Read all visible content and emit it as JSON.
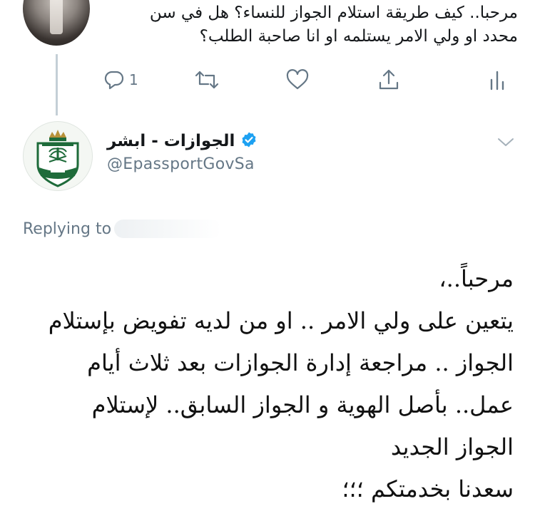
{
  "tweet": {
    "text_lines": [
      "مرحبا.. كيف طريقة استلام الجواز للنساء؟ هل في سن",
      "محدد او ولي الامر يستلمه او انا صاحبة الطلب؟"
    ],
    "reply_count": "1"
  },
  "reply": {
    "author_name": "الجوازات - ابشر",
    "handle": "@EpassportGovSa",
    "verified": true,
    "replying_to_label": "Replying to",
    "body_lines": [
      "مرحباً..،",
      "يتعين على ولي الامر .. او من لديه تفويض بإستلام",
      "الجواز .. مراجعة إدارة الجوازات بعد ثلاث أيام",
      "عمل.. بأصل الهوية و الجواز السابق.. لإستلام",
      "الجواز الجديد",
      "سعدنا بخدمتكم ؛؛؛"
    ]
  },
  "icons": {
    "reply": "reply-icon",
    "retweet": "retweet-icon",
    "like": "heart-icon",
    "share": "share-icon",
    "analytics": "analytics-icon",
    "verified": "verified-badge-icon",
    "more": "chevron-down-icon",
    "avatar_logo": "passport-emblem-icon"
  },
  "colors": {
    "text": "#14171a",
    "secondary": "#657786",
    "verified_blue": "#1da1f2",
    "thread_line": "#c4cfd6",
    "emblem_green": "#1e6b3a",
    "emblem_gold": "#b8923a"
  }
}
